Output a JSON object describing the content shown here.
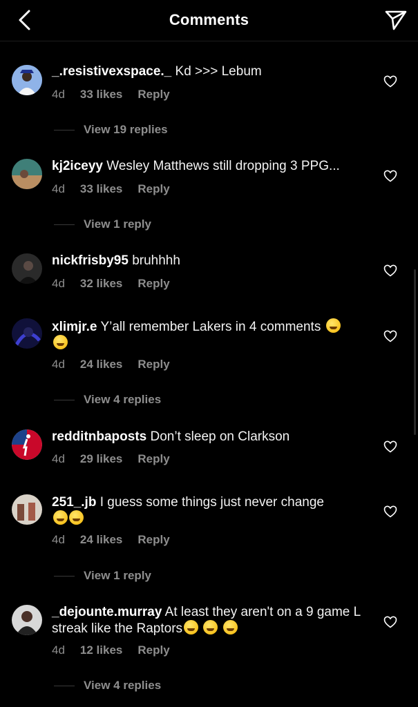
{
  "header": {
    "title": "Comments"
  },
  "comments": [
    {
      "user": "_.resistivexspace._",
      "text": "Kd >>> Lebum",
      "time": "4d",
      "likes": "33 likes",
      "reply": "Reply",
      "view": "View 19 replies",
      "avatar_color": "#4a6ea8"
    },
    {
      "user": "kj2iceyy",
      "text": "Wesley Matthews still dropping 3 PPG...",
      "time": "4d",
      "likes": "33 likes",
      "reply": "Reply",
      "view": "View 1 reply",
      "avatar_color": "#3f7f78"
    },
    {
      "user": "nickfrisby95",
      "text": "bruhhhh",
      "time": "4d",
      "likes": "32 likes",
      "reply": "Reply",
      "view": "",
      "avatar_color": "#3a3a3a"
    },
    {
      "user": "xlimjr.e",
      "text": "Y’all remember Lakers in 4 comments",
      "emojis": "😂 😂",
      "time": "4d",
      "likes": "24 likes",
      "reply": "Reply",
      "view": "View 4 replies",
      "avatar_color": "#1b1d5c"
    },
    {
      "user": "redditnbaposts",
      "text": "Don’t sleep on Clarkson",
      "time": "4d",
      "likes": "29 likes",
      "reply": "Reply",
      "view": "",
      "avatar_color": "#d42a2a"
    },
    {
      "user": "251_.jb",
      "text": "I guess some things just never change",
      "emojis": "😂😭",
      "time": "4d",
      "likes": "24 likes",
      "reply": "Reply",
      "view": "View 1 reply",
      "avatar_color": "#9a6a58"
    },
    {
      "user": "_dejounte.murray",
      "text": "At least they aren't on a 9 game L streak like the Raptors",
      "emojis": "😔 😕 😭",
      "time": "4d",
      "likes": "12 likes",
      "reply": "Reply",
      "view": "View 4 replies",
      "avatar_color": "#2d2a2a"
    }
  ],
  "icons": {
    "back": "chevron-left-icon",
    "send": "paper-plane-icon",
    "like": "heart-outline-icon"
  }
}
